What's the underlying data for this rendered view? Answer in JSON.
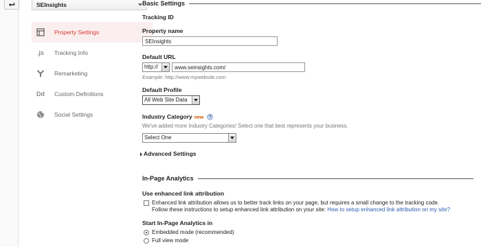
{
  "sidebar": {
    "property_name": "SEInsights",
    "items": [
      {
        "label": "Property Settings",
        "icon": "property-settings-icon",
        "active": true
      },
      {
        "label": "Tracking Info",
        "icon": "js-icon",
        "active": false
      },
      {
        "label": "Remarketing",
        "icon": "remarketing-icon",
        "active": false
      },
      {
        "label": "Custom Definitions",
        "icon": "dd-icon",
        "active": false
      },
      {
        "label": "Social Settings",
        "icon": "globe-icon",
        "active": false
      }
    ],
    "icon_text": {
      "js": ".js",
      "dd": "Dd"
    }
  },
  "basic": {
    "title": "Basic Settings",
    "tracking_id_label": "Tracking ID",
    "property_name_label": "Property name",
    "property_name_value": "SEInsights",
    "default_url_label": "Default URL",
    "protocol_value": "http://",
    "url_value": "www.seinsights.com/",
    "url_example": "Example: http://www.mywebsite.com",
    "default_profile_label": "Default Profile",
    "default_profile_value": "All Web Site Data",
    "industry_label": "Industry Category",
    "industry_new": "new",
    "industry_help_icon": "?",
    "industry_help": "We've added more Industry Categories! Select one that best represents your business.",
    "industry_value": "Select One",
    "advanced_label": "Advanced Settings"
  },
  "inpage": {
    "title": "In-Page Analytics",
    "enhanced_label": "Use enhanced link attribution",
    "enhanced_text_1": "Enhanced link attribution allows us to better track links on your page, but requires a small change to the tracking code.",
    "enhanced_text_2": "Follow these instructions to setup enhanced link attribution on your site:",
    "enhanced_link": "How to setup enhanced link attribution on my site?",
    "start_label": "Start In-Page Analytics in",
    "mode_embedded": "Embedded mode (recommended)",
    "mode_full": "Full view mode"
  },
  "colors": {
    "accent": "#d33b32",
    "active_bg": "#fbeeee",
    "link": "#2a5db0"
  }
}
